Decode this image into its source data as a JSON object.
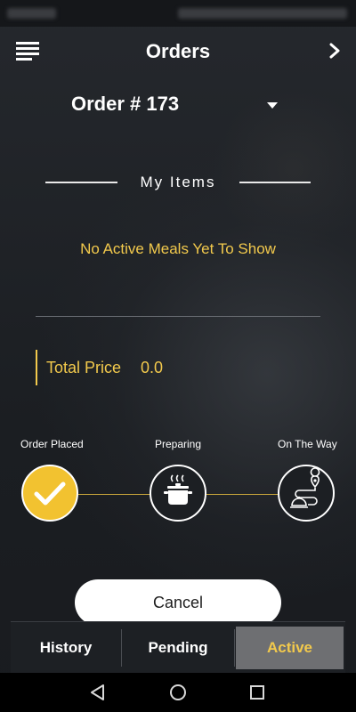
{
  "app": {
    "title": "Orders"
  },
  "order": {
    "selected_label": "Order # 173"
  },
  "items": {
    "section_title": "My Items",
    "empty_message": "No Active Meals Yet To Show"
  },
  "total": {
    "label": "Total Price",
    "value": "0.0"
  },
  "steps": [
    {
      "label": "Order Placed",
      "icon": "check-icon",
      "status": "done"
    },
    {
      "label": "Preparing",
      "icon": "cooking-pot-icon",
      "status": "pending"
    },
    {
      "label": "On The Way",
      "icon": "delivery-route-icon",
      "status": "pending"
    }
  ],
  "actions": {
    "cancel_label": "Cancel"
  },
  "tabs": [
    {
      "label": "History",
      "active": false
    },
    {
      "label": "Pending",
      "active": false
    },
    {
      "label": "Active",
      "active": true
    }
  ],
  "colors": {
    "accent": "#f2c94c",
    "background": "#1f2226",
    "active_tab_bg": "#6e6f72"
  },
  "system_nav": {
    "icons": [
      "back-icon",
      "home-icon",
      "recents-icon"
    ]
  }
}
